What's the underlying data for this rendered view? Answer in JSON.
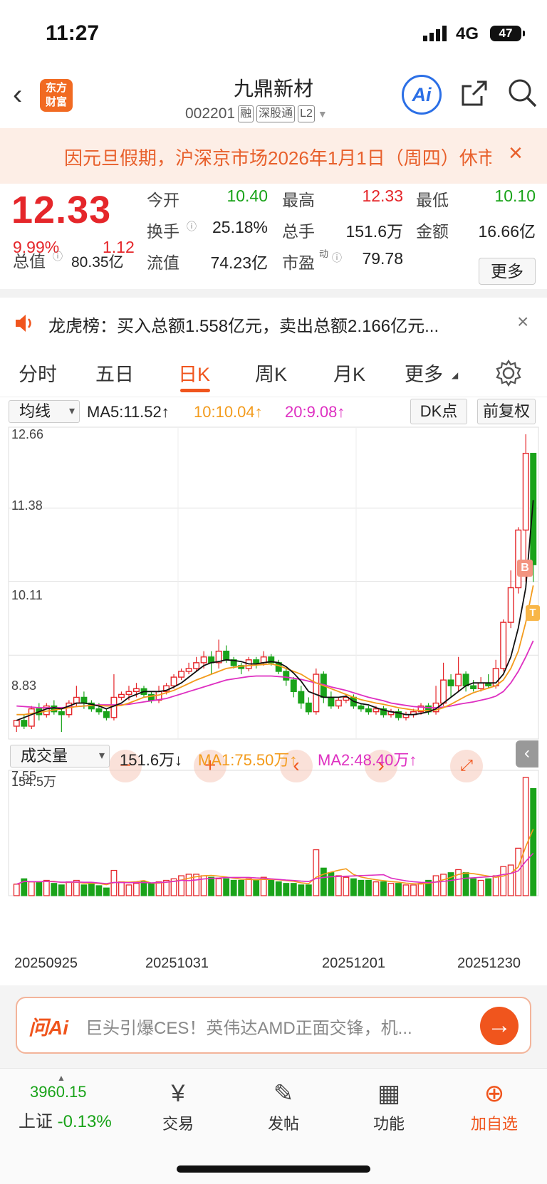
{
  "status": {
    "time": "11:27",
    "network": "4G",
    "battery": "47"
  },
  "header": {
    "back_icon": "‹",
    "logo_line1": "东方",
    "logo_line2": "财富",
    "title": "九鼎新材",
    "code": "002201",
    "tags": [
      "融",
      "深股通",
      "L2"
    ],
    "ai_label": "Ai"
  },
  "notice": {
    "text": "因元旦假期，沪深京市场2026年1月1日（周四）休市",
    "close": "×"
  },
  "quote": {
    "price": "12.33",
    "pct": "9.99%",
    "change": "1.12",
    "open_label": "今开",
    "open": "10.40",
    "high_label": "最高",
    "high": "12.33",
    "low_label": "最低",
    "low": "10.10",
    "turnover_label": "换手",
    "turnover": "25.18%",
    "volume_label": "总手",
    "volume": "151.6万",
    "amount_label": "金额",
    "amount": "16.66亿",
    "mktcap_label": "总值",
    "mktcap": "80.35亿",
    "float_label": "流值",
    "float": "74.23亿",
    "pe_label": "市盈",
    "pe_sup": "动",
    "pe": "79.78",
    "more": "更多"
  },
  "dragon": {
    "text": "龙虎榜：买入总额1.558亿元，卖出总额2.166亿元...",
    "close": "×"
  },
  "tabs": [
    "分时",
    "五日",
    "日K",
    "周K",
    "月K",
    "更多"
  ],
  "toolbar": {
    "ma_select": "均线",
    "ma5": "MA5:11.52↑",
    "ma10": "10:10.04↑",
    "ma20": "20:9.08↑",
    "dk": "DK点",
    "fq": "前复权"
  },
  "price_axis": [
    "12.66",
    "11.38",
    "10.11",
    "8.83",
    "7.55"
  ],
  "volume_bar": {
    "select": "成交量",
    "vol": "151.6万↓",
    "ma1": "MA1:75.50万↑",
    "ma2": "MA2:48.40万↑",
    "max": "154.5万"
  },
  "dates": [
    "20250925",
    "20251031",
    "20251201",
    "20251230"
  ],
  "marks": {
    "b": "B",
    "t": "T"
  },
  "chart_data": {
    "type": "candlestick",
    "candles": [
      [
        7.6,
        7.7,
        7.5,
        7.65
      ],
      [
        7.7,
        7.6,
        7.55,
        7.8
      ],
      [
        7.6,
        7.9,
        7.55,
        7.95
      ],
      [
        7.9,
        7.8,
        7.7,
        8.0
      ],
      [
        7.8,
        7.95,
        7.75,
        8.0
      ],
      [
        7.95,
        7.85,
        7.8,
        8.05
      ],
      [
        7.85,
        7.8,
        7.5,
        7.9
      ],
      [
        7.8,
        8.0,
        7.75,
        8.05
      ],
      [
        8.0,
        8.1,
        7.95,
        8.3
      ],
      [
        8.1,
        8.0,
        7.9,
        8.2
      ],
      [
        8.0,
        7.9,
        7.85,
        8.05
      ],
      [
        7.9,
        7.85,
        7.8,
        8.0
      ],
      [
        7.85,
        7.75,
        7.7,
        7.9
      ],
      [
        7.75,
        8.1,
        7.7,
        8.5
      ],
      [
        8.1,
        8.15,
        8.05,
        8.2
      ],
      [
        8.15,
        8.2,
        8.05,
        8.3
      ],
      [
        8.2,
        8.25,
        8.1,
        8.35
      ],
      [
        8.25,
        8.15,
        8.1,
        8.3
      ],
      [
        8.15,
        8.05,
        8.0,
        8.2
      ],
      [
        8.05,
        8.2,
        8.0,
        8.3
      ],
      [
        8.2,
        8.3,
        8.15,
        8.35
      ],
      [
        8.3,
        8.45,
        8.25,
        8.5
      ],
      [
        8.45,
        8.55,
        8.4,
        8.6
      ],
      [
        8.55,
        8.6,
        8.5,
        8.7
      ],
      [
        8.6,
        8.7,
        8.55,
        8.8
      ],
      [
        8.7,
        8.8,
        8.6,
        8.9
      ],
      [
        8.8,
        8.7,
        8.5,
        8.9
      ],
      [
        8.7,
        8.9,
        8.6,
        9.1
      ],
      [
        8.9,
        8.75,
        8.7,
        9.0
      ],
      [
        8.75,
        8.65,
        8.6,
        8.8
      ],
      [
        8.65,
        8.6,
        8.5,
        8.7
      ],
      [
        8.6,
        8.75,
        8.55,
        8.8
      ],
      [
        8.75,
        8.7,
        8.6,
        8.8
      ],
      [
        8.7,
        8.8,
        8.65,
        8.9
      ],
      [
        8.8,
        8.7,
        8.65,
        8.85
      ],
      [
        8.7,
        8.55,
        8.5,
        8.75
      ],
      [
        8.55,
        8.4,
        8.3,
        8.6
      ],
      [
        8.4,
        8.2,
        8.1,
        8.45
      ],
      [
        8.2,
        8.0,
        7.9,
        8.3
      ],
      [
        8.0,
        7.85,
        7.8,
        8.1
      ],
      [
        7.85,
        8.5,
        7.8,
        8.6
      ],
      [
        8.5,
        8.1,
        8.0,
        8.55
      ],
      [
        8.1,
        7.95,
        7.9,
        8.2
      ],
      [
        7.95,
        8.05,
        7.9,
        8.1
      ],
      [
        8.05,
        8.1,
        8.0,
        8.15
      ],
      [
        8.1,
        7.95,
        7.9,
        8.15
      ],
      [
        7.95,
        7.9,
        7.85,
        8.0
      ],
      [
        7.9,
        7.85,
        7.8,
        7.95
      ],
      [
        7.85,
        7.9,
        7.8,
        7.95
      ],
      [
        7.9,
        7.8,
        7.75,
        7.95
      ],
      [
        7.8,
        7.85,
        7.75,
        7.9
      ],
      [
        7.85,
        7.75,
        7.7,
        7.9
      ],
      [
        7.75,
        7.8,
        7.7,
        7.85
      ],
      [
        7.8,
        7.85,
        7.75,
        7.9
      ],
      [
        7.85,
        7.95,
        7.8,
        8.0
      ],
      [
        7.95,
        7.85,
        7.8,
        8.0
      ],
      [
        7.85,
        8.0,
        7.8,
        8.3
      ],
      [
        8.0,
        8.4,
        7.95,
        8.7
      ],
      [
        8.4,
        8.3,
        8.1,
        8.5
      ],
      [
        8.3,
        8.5,
        8.2,
        8.8
      ],
      [
        8.5,
        8.3,
        8.2,
        8.55
      ],
      [
        8.3,
        8.25,
        8.2,
        8.4
      ],
      [
        8.25,
        8.35,
        8.2,
        8.45
      ],
      [
        8.35,
        8.3,
        8.25,
        8.5
      ],
      [
        8.3,
        8.6,
        8.25,
        8.75
      ],
      [
        8.6,
        9.4,
        8.55,
        9.45
      ],
      [
        9.4,
        10.0,
        9.3,
        10.3
      ],
      [
        10.0,
        11.0,
        9.9,
        11.05
      ],
      [
        11.0,
        12.33,
        10.1,
        12.66
      ],
      [
        12.33,
        10.4,
        10.1,
        12.33
      ]
    ],
    "ma5": [
      7.7,
      7.75,
      7.8,
      7.85,
      7.9,
      7.92,
      7.9,
      7.95,
      8.0,
      8.0,
      7.98,
      7.95,
      7.9,
      7.95,
      8.0,
      8.1,
      8.15,
      8.2,
      8.2,
      8.2,
      8.22,
      8.28,
      8.35,
      8.45,
      8.55,
      8.65,
      8.7,
      8.72,
      8.75,
      8.74,
      8.72,
      8.68,
      8.68,
      8.7,
      8.72,
      8.7,
      8.63,
      8.52,
      8.38,
      8.2,
      8.15,
      8.1,
      8.1,
      8.1,
      8.12,
      8.03,
      7.99,
      7.97,
      7.92,
      7.88,
      7.85,
      7.83,
      7.8,
      7.8,
      7.82,
      7.85,
      7.9,
      8.0,
      8.1,
      8.2,
      8.3,
      8.35,
      8.35,
      8.35,
      8.35,
      8.5,
      8.8,
      9.3,
      10.0,
      11.52
    ],
    "ma10": [
      7.8,
      7.8,
      7.82,
      7.84,
      7.86,
      7.88,
      7.9,
      7.92,
      7.94,
      7.95,
      7.96,
      7.96,
      7.95,
      7.95,
      7.96,
      8.0,
      8.05,
      8.1,
      8.12,
      8.14,
      8.18,
      8.22,
      8.28,
      8.34,
      8.4,
      8.45,
      8.5,
      8.55,
      8.6,
      8.62,
      8.64,
      8.65,
      8.66,
      8.67,
      8.68,
      8.65,
      8.6,
      8.55,
      8.5,
      8.42,
      8.35,
      8.3,
      8.25,
      8.2,
      8.15,
      8.1,
      8.06,
      8.03,
      8.0,
      7.98,
      7.95,
      7.92,
      7.9,
      7.88,
      7.87,
      7.87,
      7.88,
      7.92,
      7.98,
      8.05,
      8.12,
      8.18,
      8.22,
      8.26,
      8.3,
      8.4,
      8.6,
      8.9,
      9.4,
      10.04
    ],
    "ma20": [
      7.95,
      7.94,
      7.93,
      7.92,
      7.92,
      7.92,
      7.92,
      7.93,
      7.94,
      7.95,
      7.96,
      7.97,
      7.97,
      7.97,
      7.97,
      7.98,
      8.0,
      8.02,
      8.04,
      8.06,
      8.08,
      8.12,
      8.16,
      8.2,
      8.24,
      8.28,
      8.32,
      8.36,
      8.4,
      8.42,
      8.44,
      8.46,
      8.47,
      8.47,
      8.47,
      8.46,
      8.45,
      8.43,
      8.41,
      8.38,
      8.35,
      8.32,
      8.28,
      8.25,
      8.22,
      8.18,
      8.14,
      8.1,
      8.07,
      8.04,
      8.0,
      7.98,
      7.96,
      7.94,
      7.93,
      7.92,
      7.92,
      7.93,
      7.95,
      7.98,
      8.0,
      8.02,
      8.05,
      8.08,
      8.12,
      8.2,
      8.35,
      8.55,
      8.8,
      9.08
    ],
    "volume": [
      15,
      22,
      18,
      18,
      20,
      16,
      14,
      18,
      20,
      14,
      15,
      13,
      10,
      33,
      18,
      14,
      16,
      18,
      16,
      18,
      20,
      22,
      26,
      28,
      28,
      26,
      24,
      22,
      22,
      20,
      20,
      22,
      20,
      24,
      20,
      18,
      16,
      16,
      14,
      14,
      60,
      36,
      30,
      26,
      24,
      22,
      20,
      20,
      18,
      18,
      16,
      16,
      14,
      14,
      16,
      20,
      26,
      28,
      30,
      34,
      30,
      22,
      20,
      22,
      26,
      38,
      40,
      62,
      154.5,
      140
    ],
    "ylim": [
      7.55,
      12.66
    ]
  }
}
